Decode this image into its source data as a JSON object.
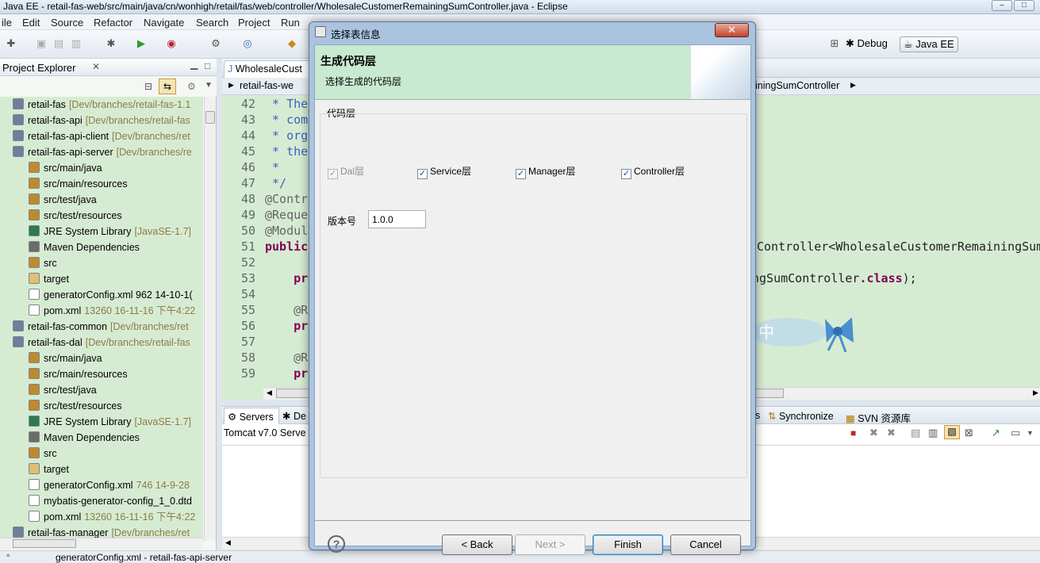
{
  "window": {
    "title": "Java EE - retail-fas-web/src/main/java/cn/wonhigh/retail/fas/web/controller/WholesaleCustomerRemainingSumController.java - Eclipse"
  },
  "menu": [
    "ile",
    "Edit",
    "Source",
    "Refactor",
    "Navigate",
    "Search",
    "Project",
    "Run"
  ],
  "perspectives": {
    "debug": "Debug",
    "javaee": "Java EE"
  },
  "explorer": {
    "title": "Project Explorer",
    "rows": [
      {
        "label": "retail-fas",
        "meta": "[Dev/branches/retail-fas-1.1"
      },
      {
        "label": "retail-fas-api",
        "meta": "[Dev/branches/retail-fas"
      },
      {
        "label": "retail-fas-api-client",
        "meta": "[Dev/branches/ret"
      },
      {
        "label": "retail-fas-api-server",
        "meta": "[Dev/branches/re"
      },
      {
        "label": "src/main/java",
        "meta": ""
      },
      {
        "label": "src/main/resources",
        "meta": ""
      },
      {
        "label": "src/test/java",
        "meta": ""
      },
      {
        "label": "src/test/resources",
        "meta": ""
      },
      {
        "label": "JRE System Library",
        "meta": "[JavaSE-1.7]"
      },
      {
        "label": "Maven Dependencies",
        "meta": ""
      },
      {
        "label": "src",
        "meta": ""
      },
      {
        "label": "target",
        "meta": ""
      },
      {
        "label": "generatorConfig.xml 962  14-10-1(",
        "meta": ""
      },
      {
        "label": "pom.xml",
        "meta": "13260  16-11-16 下午4:22"
      },
      {
        "label": "retail-fas-common",
        "meta": "[Dev/branches/ret"
      },
      {
        "label": "retail-fas-dal",
        "meta": "[Dev/branches/retail-fas"
      },
      {
        "label": "src/main/java",
        "meta": ""
      },
      {
        "label": "src/main/resources",
        "meta": ""
      },
      {
        "label": "src/test/java",
        "meta": ""
      },
      {
        "label": "src/test/resources",
        "meta": ""
      },
      {
        "label": "JRE System Library",
        "meta": "[JavaSE-1.7]"
      },
      {
        "label": "Maven Dependencies",
        "meta": ""
      },
      {
        "label": "src",
        "meta": ""
      },
      {
        "label": "target",
        "meta": ""
      },
      {
        "label": "generatorConfig.xml",
        "meta": "746  14-9-28"
      },
      {
        "label": "mybatis-generator-config_1_0.dtd",
        "meta": ""
      },
      {
        "label": "pom.xml",
        "meta": "13260  16-11-16 下午4:22"
      },
      {
        "label": "retail-fas-manager",
        "meta": "[Dev/branches/ret"
      }
    ]
  },
  "editor": {
    "tab": "WholesaleCust",
    "breadcrumb_left": "retail-fas-we",
    "breadcrumb_right": "iningSumController",
    "lines": [
      {
        "num": "42",
        "text": " * The"
      },
      {
        "num": "43",
        "text": " * com"
      },
      {
        "num": "44",
        "text": " * org"
      },
      {
        "num": "45",
        "text": " * the"
      },
      {
        "num": "46",
        "text": " *"
      },
      {
        "num": "47",
        "text": " */"
      },
      {
        "num": "48",
        "text": "@Contr"
      },
      {
        "num": "49",
        "text": "@Reque"
      },
      {
        "num": "50",
        "text": "@Modul"
      },
      {
        "num": "51",
        "text": "public"
      },
      {
        "num": "52",
        "text": ""
      },
      {
        "num": "53",
        "text": "    pr"
      },
      {
        "num": "54",
        "text": ""
      },
      {
        "num": "55",
        "text": "    @R"
      },
      {
        "num": "56",
        "text": "    pr"
      },
      {
        "num": "57",
        "text": ""
      },
      {
        "num": "58",
        "text": "    @R"
      },
      {
        "num": "59",
        "text": "    pr"
      }
    ],
    "right_line51": "Controller<WholesaleCustomerRemainingSum",
    "right_line53_a": "ngSumController",
    "right_line53_b": ".class",
    "right_line53_c": ");"
  },
  "bottom": {
    "tabs": [
      "Servers",
      "De"
    ],
    "right_tabs": [
      "s",
      "Synchronize",
      "SVN 资源库"
    ],
    "server_row": "Tomcat v7.0 Serve"
  },
  "status": {
    "text": "generatorConfig.xml - retail-fas-api-server"
  },
  "dialog": {
    "title": "选择表信息",
    "heading": "生成代码层",
    "subheading": "选择生成的代码层",
    "group_label": "代码层",
    "options": [
      {
        "label": "Dal层",
        "checked": true,
        "enabled": false
      },
      {
        "label": "Service层",
        "checked": true,
        "enabled": true
      },
      {
        "label": "Manager层",
        "checked": true,
        "enabled": true
      },
      {
        "label": "Controller层",
        "checked": true,
        "enabled": true
      }
    ],
    "version_label": "版本号",
    "version_value": "1.0.0",
    "buttons": {
      "back": "< Back",
      "next": "Next >",
      "finish": "Finish",
      "cancel": "Cancel"
    },
    "help": "?"
  }
}
